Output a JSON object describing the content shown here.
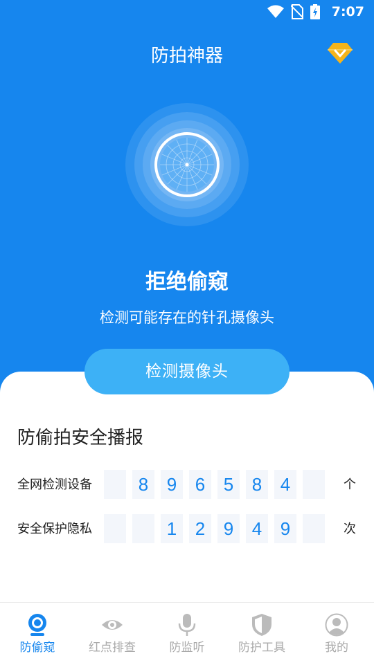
{
  "status_bar": {
    "time": "7:07"
  },
  "header": {
    "title": "防拍神器",
    "vip_icon": "diamond-vip-icon"
  },
  "hero": {
    "headline": "拒绝偷窥",
    "subline": "检测可能存在的针孔摄像头"
  },
  "detect_button": {
    "label": "检测摄像头"
  },
  "report": {
    "title": "防偷拍安全播报",
    "rows": [
      {
        "label": "全网检测设备",
        "digits": [
          "",
          "8",
          "9",
          "6",
          "5",
          "8",
          "4",
          ""
        ],
        "unit": "个"
      },
      {
        "label": "安全保护隐私",
        "digits": [
          "",
          "",
          "1",
          "2",
          "9",
          "4",
          "9",
          ""
        ],
        "unit": "次"
      }
    ]
  },
  "tabs": [
    {
      "label": "防偷窥",
      "icon": "webcam-icon",
      "active": true
    },
    {
      "label": "红点排查",
      "icon": "eye-icon",
      "active": false
    },
    {
      "label": "防监听",
      "icon": "microphone-icon",
      "active": false
    },
    {
      "label": "防护工具",
      "icon": "shield-icon",
      "active": false
    },
    {
      "label": "我的",
      "icon": "user-icon",
      "active": false
    }
  ],
  "colors": {
    "primary": "#1686ee",
    "button": "#3db1f6",
    "inactive": "#aaaaaa"
  }
}
